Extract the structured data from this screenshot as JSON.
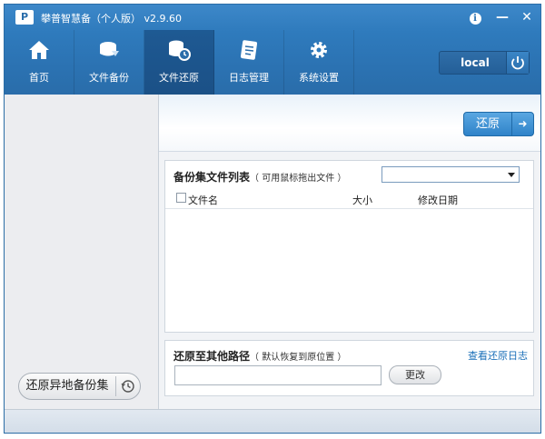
{
  "app": {
    "title": "攀普智慧备（个人版） v2.9.60",
    "logo_text": "P"
  },
  "window_controls": {
    "info_icon": "info-icon",
    "minimize_label": "—",
    "close_label": "✕"
  },
  "nav": {
    "items": [
      {
        "label": "首页",
        "icon": "home-icon",
        "active": false
      },
      {
        "label": "文件备份",
        "icon": "file-backup-icon",
        "active": false
      },
      {
        "label": "文件还原",
        "icon": "file-restore-icon",
        "active": true
      },
      {
        "label": "日志管理",
        "icon": "log-icon",
        "active": false
      },
      {
        "label": "系统设置",
        "icon": "gear-icon",
        "active": false
      }
    ],
    "connection_label": "local",
    "power_icon": "power-icon"
  },
  "left_panel": {
    "remote_button_label": "还原异地备份集",
    "history_icon": "history-icon"
  },
  "restore": {
    "button_label": "还原",
    "arrow": "➜"
  },
  "file_list": {
    "title": "备份集文件列表",
    "hint": "（ 可用鼠标拖出文件 ）",
    "selected_backup": "",
    "columns": {
      "name": "文件名",
      "size": "大小",
      "modified": "修改日期"
    },
    "rows": []
  },
  "restore_path": {
    "title": "还原至其他路径",
    "hint": "（ 默认恢复到原位置 ）",
    "log_link": "查看还原日志",
    "path_value": "",
    "change_label": "更改"
  },
  "colors": {
    "toolbar": "#2f7bbd",
    "accent": "#2f83c9",
    "link": "#1a6fb8"
  }
}
